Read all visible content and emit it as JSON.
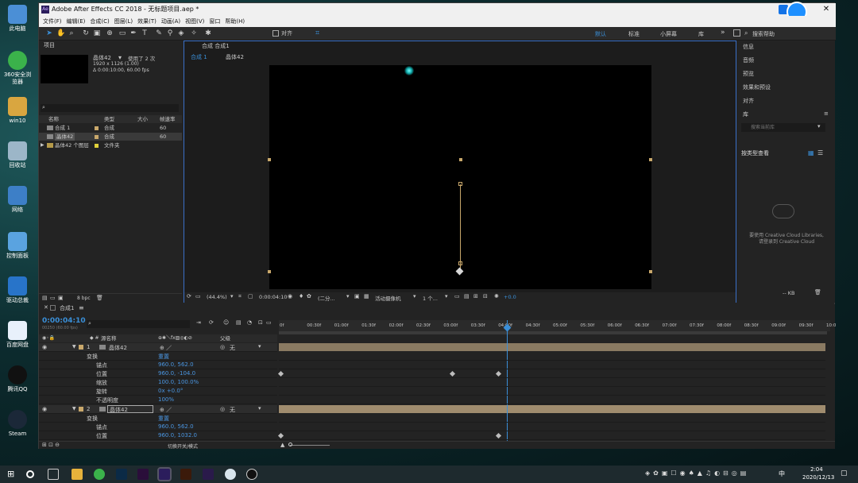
{
  "desktop": {
    "icons": [
      "此电脑",
      "360安全浏览器",
      "win10",
      "回收站",
      "网络",
      "控制面板",
      "驱动总裁",
      "百度网盘",
      "腾讯QQ",
      "Steam"
    ]
  },
  "window": {
    "title": "Adobe After Effects CC 2018 - 无标题项目.aep *",
    "logo": "Ae"
  },
  "menu": [
    "文件(F)",
    "编辑(E)",
    "合成(C)",
    "图层(L)",
    "效果(T)",
    "动画(A)",
    "视图(V)",
    "窗口",
    "帮助(H)"
  ],
  "toolbar": {
    "align_label": "对齐",
    "workspaces": [
      "默认",
      "标准",
      "小屏幕",
      "库"
    ],
    "search_placeholder": "搜索帮助"
  },
  "project": {
    "header": "项目",
    "item_name": "晶体42",
    "usage": "使用了 2 次",
    "dims": "1920 x 1126 (1.00)",
    "duration": "Δ 0:00:10:00, 60.00 fps",
    "columns": [
      "名称",
      "类型",
      "大小",
      "帧速率"
    ],
    "rows": [
      {
        "name": "合成 1",
        "type": "合成",
        "rate": "60"
      },
      {
        "name": "晶体42",
        "type": "合成",
        "rate": "60"
      },
      {
        "name": "晶体42 个图层",
        "type": "文件夹",
        "rate": ""
      }
    ],
    "bpc": "8 bpc"
  },
  "comp": {
    "header": "合成 合成1",
    "tab1": "合成 1",
    "tab2": "晶体42",
    "zoom": "(44.4%)",
    "time": "0:00:04:10",
    "res": "(二分...",
    "camera": "活动摄像机",
    "views": "1 个...",
    "exposure": "+0.0"
  },
  "right": {
    "items": [
      "信息",
      "音频",
      "预览",
      "效果和预设",
      "对齐"
    ],
    "lib_header": "库",
    "lib_search": "搜索当前库",
    "view_label": "按类型查看",
    "cc_msg1": "要使用 Creative Cloud Libraries,",
    "cc_msg2": "请登录到 Creative Cloud",
    "kb": "-- KB"
  },
  "timeline": {
    "tab": "合成1",
    "current_time": "0:00:04:10",
    "fps_info": "00250 (60.00 fps)",
    "col_layer": "源名称",
    "col_parent": "父级",
    "ticks": [
      "0f",
      "00:30f",
      "01:00f",
      "01:30f",
      "02:00f",
      "02:30f",
      "03:00f",
      "03:30f",
      "04:00f",
      "04:30f",
      "05:00f",
      "05:30f",
      "06:00f",
      "06:30f",
      "07:00f",
      "07:30f",
      "08:00f",
      "08:30f",
      "09:00f",
      "09:30f",
      "10:0"
    ],
    "layers": [
      {
        "num": "1",
        "name": "晶体42",
        "parent": "无"
      },
      {
        "num": "2",
        "name": "晶体42",
        "parent": "无"
      }
    ],
    "props1": [
      {
        "name": "变换",
        "value": "重置"
      },
      {
        "name": "锚点",
        "value": "960.0, 562.0"
      },
      {
        "name": "位置",
        "value": "960.0, -104.0"
      },
      {
        "name": "缩放",
        "value": "100.0, 100.0%"
      },
      {
        "name": "旋转",
        "value": "0x +0.0°"
      },
      {
        "name": "不透明度",
        "value": "100%"
      }
    ],
    "props2": [
      {
        "name": "变换",
        "value": "重置"
      },
      {
        "name": "锚点",
        "value": "960.0, 562.0"
      },
      {
        "name": "位置",
        "value": "960.0, 1032.0"
      }
    ],
    "footer": "切换开关/模式"
  },
  "taskbar": {
    "time": "2:04",
    "date": "2020/12/13",
    "lang": "中"
  }
}
